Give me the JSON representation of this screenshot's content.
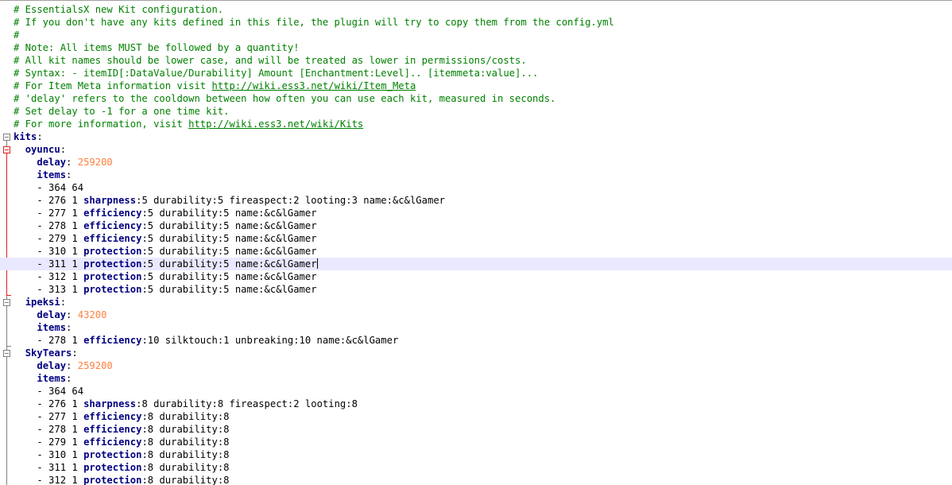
{
  "editor": {
    "current_line_index": 20,
    "lines": [
      {
        "type": "comment",
        "text": "# EssentialsX new Kit configuration."
      },
      {
        "type": "comment",
        "text": "# If you don't have any kits defined in this file, the plugin will try to copy them from the config.yml"
      },
      {
        "type": "comment",
        "text": "#"
      },
      {
        "type": "comment",
        "text": "# Note: All items MUST be followed by a quantity!"
      },
      {
        "type": "comment",
        "text": "# All kit names should be lower case, and will be treated as lower in permissions/costs."
      },
      {
        "type": "comment",
        "text": "# Syntax: - itemID[:DataValue/Durability] Amount [Enchantment:Level].. [itemmeta:value]..."
      },
      {
        "type": "comment_link",
        "text": "# For Item Meta information visit ",
        "link": "http://wiki.ess3.net/wiki/Item_Meta"
      },
      {
        "type": "comment",
        "text": "# 'delay' refers to the cooldown between how often you can use each kit, measured in seconds."
      },
      {
        "type": "comment",
        "text": "# Set delay to -1 for a one time kit."
      },
      {
        "type": "comment_link",
        "text": "# For more information, visit ",
        "link": "http://wiki.ess3.net/wiki/Kits"
      },
      {
        "type": "key",
        "indent": "",
        "key": "kits",
        "colon": ":"
      },
      {
        "type": "key",
        "indent": "  ",
        "key": "oyuncu",
        "colon": ":"
      },
      {
        "type": "keyval",
        "indent": "    ",
        "key": "delay",
        "colon": ": ",
        "value": "259200"
      },
      {
        "type": "key",
        "indent": "    ",
        "key": "items",
        "colon": ":"
      },
      {
        "type": "item",
        "indent": "    ",
        "text": "- 364 64"
      },
      {
        "type": "item",
        "indent": "    ",
        "text": "- 276 1 ",
        "ench": "sharpness",
        "rest": ":5 durability:5 fireaspect:2 looting:3 name:&c&lGamer"
      },
      {
        "type": "item",
        "indent": "    ",
        "text": "- 277 1 ",
        "ench": "efficiency",
        "rest": ":5 durability:5 name:&c&lGamer"
      },
      {
        "type": "item",
        "indent": "    ",
        "text": "- 278 1 ",
        "ench": "efficiency",
        "rest": ":5 durability:5 name:&c&lGamer"
      },
      {
        "type": "item",
        "indent": "    ",
        "text": "- 279 1 ",
        "ench": "efficiency",
        "rest": ":5 durability:5 name:&c&lGamer"
      },
      {
        "type": "item",
        "indent": "    ",
        "text": "- 310 1 ",
        "ench": "protection",
        "rest": ":5 durability:5 name:&c&lGamer"
      },
      {
        "type": "item",
        "indent": "    ",
        "text": "- 311 1 ",
        "ench": "protection",
        "rest": ":5 durability:5 name:&c&lGamer"
      },
      {
        "type": "item",
        "indent": "    ",
        "text": "- 312 1 ",
        "ench": "protection",
        "rest": ":5 durability:5 name:&c&lGamer"
      },
      {
        "type": "item",
        "indent": "    ",
        "text": "- 313 1 ",
        "ench": "protection",
        "rest": ":5 durability:5 name:&c&lGamer"
      },
      {
        "type": "key",
        "indent": "  ",
        "key": "ipeksi",
        "colon": ":"
      },
      {
        "type": "keyval",
        "indent": "    ",
        "key": "delay",
        "colon": ": ",
        "value": "43200"
      },
      {
        "type": "key",
        "indent": "    ",
        "key": "items",
        "colon": ":"
      },
      {
        "type": "item",
        "indent": "    ",
        "text": "- 278 1 ",
        "ench": "efficiency",
        "rest": ":10 silktouch:1 unbreaking:10 name:&c&lGamer"
      },
      {
        "type": "key",
        "indent": "  ",
        "key": "SkyTears",
        "colon": ":"
      },
      {
        "type": "keyval",
        "indent": "    ",
        "key": "delay",
        "colon": ": ",
        "value": "259200"
      },
      {
        "type": "key",
        "indent": "    ",
        "key": "items",
        "colon": ":"
      },
      {
        "type": "item",
        "indent": "    ",
        "text": "- 364 64"
      },
      {
        "type": "item",
        "indent": "    ",
        "text": "- 276 1 ",
        "ench": "sharpness",
        "rest": ":8 durability:8 fireaspect:2 looting:8"
      },
      {
        "type": "item",
        "indent": "    ",
        "text": "- 277 1 ",
        "ench": "efficiency",
        "rest": ":8 durability:8"
      },
      {
        "type": "item",
        "indent": "    ",
        "text": "- 278 1 ",
        "ench": "efficiency",
        "rest": ":8 durability:8"
      },
      {
        "type": "item",
        "indent": "    ",
        "text": "- 279 1 ",
        "ench": "efficiency",
        "rest": ":8 durability:8"
      },
      {
        "type": "item",
        "indent": "    ",
        "text": "- 310 1 ",
        "ench": "protection",
        "rest": ":8 durability:8"
      },
      {
        "type": "item",
        "indent": "    ",
        "text": "- 311 1 ",
        "ench": "protection",
        "rest": ":8 durability:8"
      },
      {
        "type": "item",
        "indent": "    ",
        "text": "- 312 1 ",
        "ench": "protection",
        "rest": ":8 durability:8"
      }
    ]
  }
}
